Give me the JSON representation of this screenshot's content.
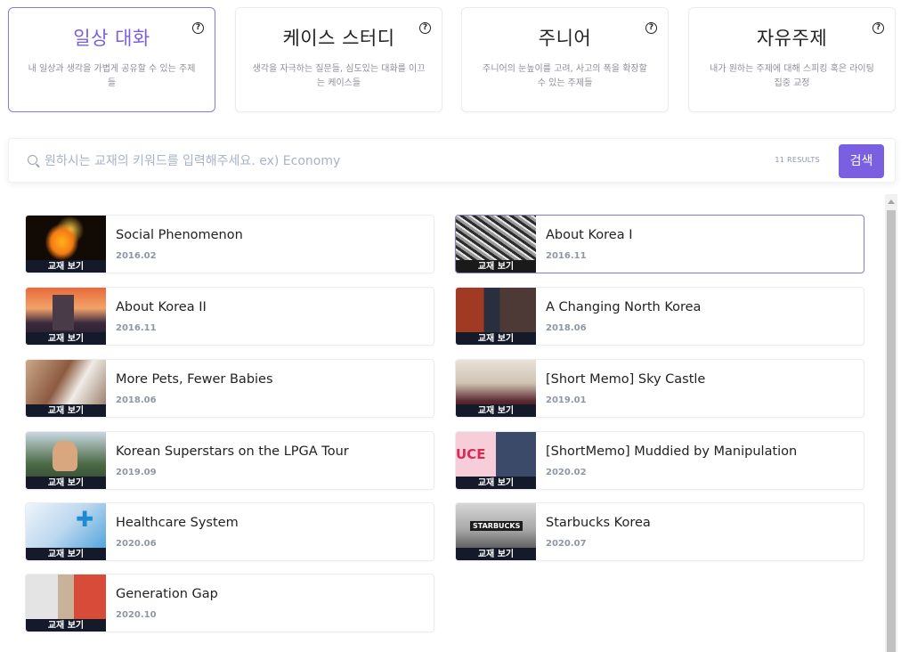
{
  "categories": [
    {
      "title": "일상 대화",
      "desc": "내 일상과 생각을 가볍게 공유할 수 있는 주제들",
      "active": true
    },
    {
      "title": "케이스 스터디",
      "desc": "생각을 자극하는 질문들, 심도있는 대화를 이끄는 케이스들"
    },
    {
      "title": "주니어",
      "desc": "주니어의 눈높이를 고려, 사고의 폭을 확장할 수 있는 주제들"
    },
    {
      "title": "자유주제",
      "desc": "내가 원하는 주제에 대해 스피킹 혹은 라이팅 집중 교정"
    }
  ],
  "help_glyph": "?",
  "search": {
    "placeholder": "원하시는 교재의 키워드를 입력해주세요. ex) Economy",
    "results": "11 RESULTS",
    "button": "검색"
  },
  "thumb_caption": "교재 보기",
  "items": [
    {
      "title": "Social Phenomenon",
      "date": "2016.02"
    },
    {
      "title": "About Korea I",
      "date": "2016.11"
    },
    {
      "title": "About Korea II",
      "date": "2016.11"
    },
    {
      "title": "A Changing North Korea",
      "date": "2018.06"
    },
    {
      "title": "More Pets, Fewer Babies",
      "date": "2018.06"
    },
    {
      "title": "[Short Memo] Sky Castle",
      "date": "2019.01"
    },
    {
      "title": "Korean Superstars on the LPGA Tour",
      "date": "2019.09"
    },
    {
      "title": "[ShortMemo] Muddied by Manipulation",
      "date": "2020.02"
    },
    {
      "title": "Healthcare System",
      "date": "2020.06"
    },
    {
      "title": "Starbucks Korea",
      "date": "2020.07"
    },
    {
      "title": "Generation Gap",
      "date": "2020.10"
    }
  ],
  "colors": {
    "accent": "#7a5fe0",
    "caption_bg": "#141a2a"
  }
}
